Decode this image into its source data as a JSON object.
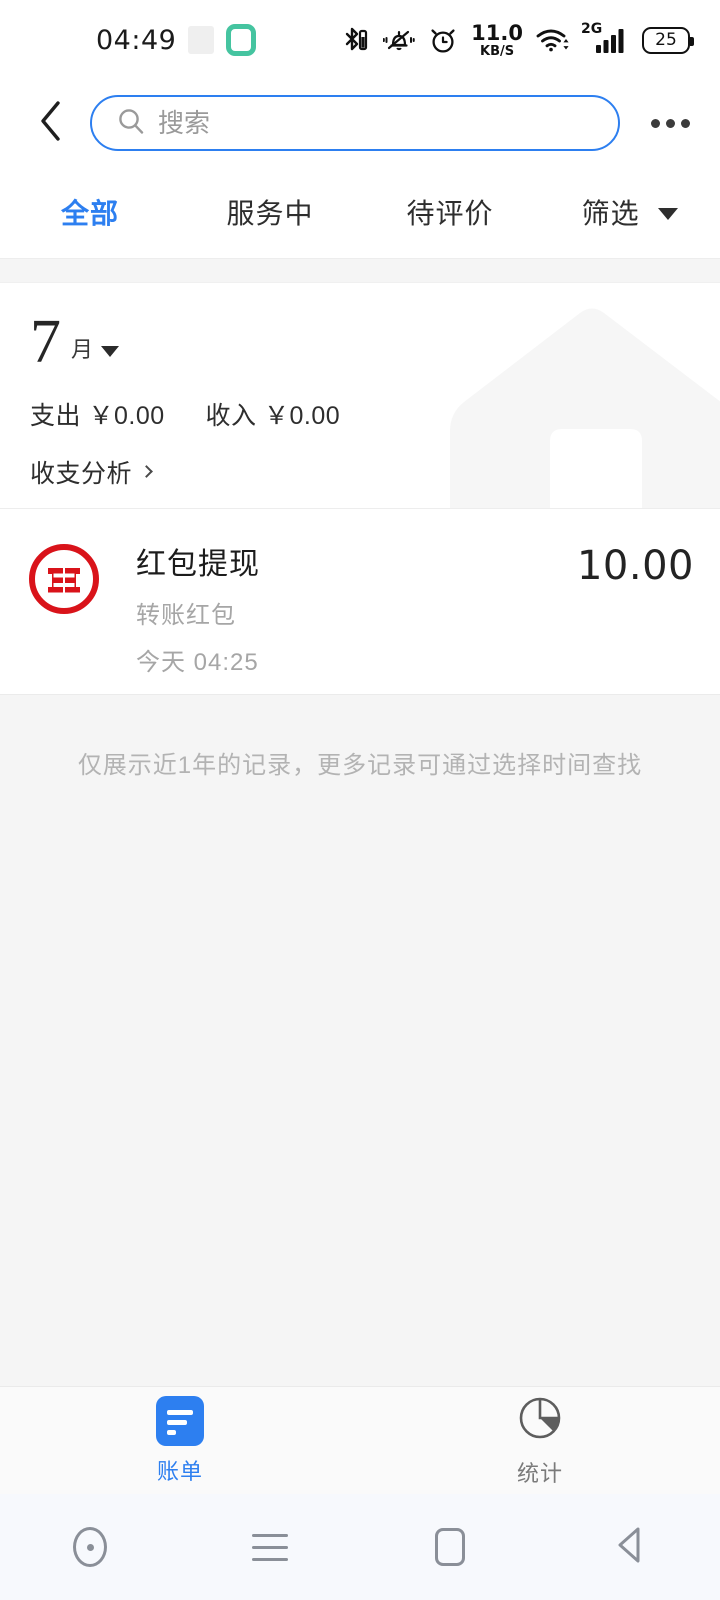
{
  "statusbar": {
    "time": "04:49",
    "network_speed_value": "11.0",
    "network_speed_unit": "KB/S",
    "mobile_network": "2G",
    "battery_level": "25",
    "icons": [
      "bluetooth-icon",
      "vibrate-icon",
      "alarm-icon",
      "wifi-icon",
      "signal-icon",
      "battery-icon"
    ]
  },
  "topbar": {
    "back_label": "返回",
    "search_placeholder": "搜索",
    "search_value": "",
    "more_label": "更多"
  },
  "tabs": {
    "items": [
      {
        "label": "全部",
        "active": true
      },
      {
        "label": "服务中",
        "active": false
      },
      {
        "label": "待评价",
        "active": false
      },
      {
        "label": "筛选",
        "active": false,
        "has_caret": true
      }
    ]
  },
  "summary": {
    "month_number": "7",
    "month_unit": "月",
    "expense_label": "支出",
    "expense_amount": "￥0.00",
    "income_label": "收入",
    "income_amount": "￥0.00",
    "analysis_label": "收支分析"
  },
  "transactions": [
    {
      "logo": "icbc-logo",
      "title": "红包提现",
      "subtitle": "转账红包",
      "time": "今天  04:25",
      "amount": "10.00"
    }
  ],
  "footer_note": "仅展示近1年的记录，更多记录可通过选择时间查找",
  "bottom_tabs": {
    "items": [
      {
        "label": "账单",
        "icon": "bill-icon",
        "active": true
      },
      {
        "label": "统计",
        "icon": "pie-chart-icon",
        "active": false
      }
    ]
  },
  "navbar": {
    "items": [
      {
        "name": "assistant-circle-icon"
      },
      {
        "name": "menu-icon"
      },
      {
        "name": "home-icon"
      },
      {
        "name": "back-icon"
      }
    ]
  },
  "colors": {
    "accent_blue": "#2d7ff0",
    "brand_red": "#d9131a",
    "status_green": "#45c4a0",
    "page_gray": "#f5f5f5",
    "muted_text": "#a6a6a6"
  }
}
